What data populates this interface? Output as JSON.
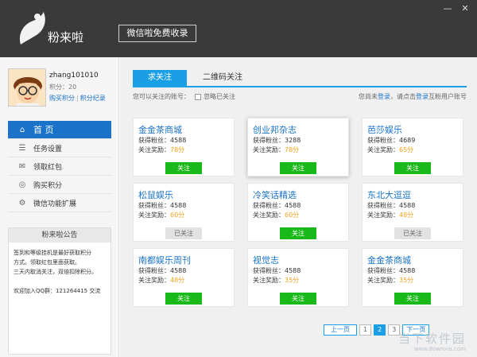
{
  "app": {
    "name": "粉来啦",
    "tagline": "微信啦免费收录"
  },
  "window": {
    "minimize": "—",
    "close": "✕"
  },
  "profile": {
    "username": "zhang101010",
    "points_label": "积分：20",
    "buy_points": "购买积分",
    "separator": "|",
    "points_record": "积分纪录"
  },
  "nav": [
    {
      "label": "首 页",
      "icon": "house-icon",
      "glyph": "⌂"
    },
    {
      "label": "任务设置",
      "icon": "list-icon",
      "glyph": "☰"
    },
    {
      "label": "领取红包",
      "icon": "gift-icon",
      "glyph": "✉"
    },
    {
      "label": "购买积分",
      "icon": "coins-icon",
      "glyph": "◎"
    },
    {
      "label": "微信功能扩展",
      "icon": "gear-icon",
      "glyph": "⚙"
    }
  ],
  "notice": {
    "title": "粉来啦公告",
    "line1": "签到和等级挂机是最好获取积分",
    "line2": "方式。领取红包里面获取。",
    "line3": "三天内取消关注，双倍扣除积分。",
    "qq": "欢迎加入QQ群：121264415 交流"
  },
  "tabs": {
    "active": "求关注",
    "inactive": "二维码关注"
  },
  "subbar": {
    "left": "您可以关注的账号：",
    "ignore": "忽略已关注",
    "right_prefix": "您尚未",
    "login1": "登录",
    "right_mid": "，请点击",
    "login2": "登录",
    "right_suffix": "互粉用户账号"
  },
  "cards": [
    {
      "title": "金金茶商城",
      "fans": "获得粉丝：4588",
      "reward_label": "关注奖励：",
      "reward": "78分",
      "button": "关注",
      "followed": false
    },
    {
      "title": "创业邦杂志",
      "fans": "获得粉丝：3288",
      "reward_label": "关注奖励：",
      "reward": "78分",
      "button": "关注",
      "followed": false
    },
    {
      "title": "芭莎娱乐",
      "fans": "获得粉丝：4689",
      "reward_label": "关注奖励：",
      "reward": "65分",
      "button": "关注",
      "followed": false
    },
    {
      "title": "松鼠娱乐",
      "fans": "获得粉丝：4588",
      "reward_label": "关注奖励：",
      "reward": "60分",
      "button": "已关注",
      "followed": true
    },
    {
      "title": "冷笑话精选",
      "fans": "获得粉丝：4588",
      "reward_label": "关注奖励：",
      "reward": "60分",
      "button": "关注",
      "followed": false
    },
    {
      "title": "东北大逗逗",
      "fans": "获得粉丝：4588",
      "reward_label": "关注奖励：",
      "reward": "48分",
      "button": "已关注",
      "followed": true
    },
    {
      "title": "南都娱乐周刊",
      "fans": "获得粉丝：4588",
      "reward_label": "关注奖励：",
      "reward": "48分",
      "button": "关注",
      "followed": false
    },
    {
      "title": "视觉志",
      "fans": "获得粉丝：4588",
      "reward_label": "关注奖励：",
      "reward": "35分",
      "button": "关注",
      "followed": false
    },
    {
      "title": "金金茶商城",
      "fans": "获得粉丝：4588",
      "reward_label": "关注奖励：",
      "reward": "35分",
      "button": "关注",
      "followed": false
    }
  ],
  "pager": {
    "prev": "上一页",
    "p1": "1",
    "p2": "2",
    "p3": "3",
    "next": "下一页"
  },
  "watermark": {
    "text": "当下软件园",
    "url": "www.downxia.com"
  },
  "colors": {
    "accent": "#1a9fe6",
    "link": "#1a73c9",
    "follow_button": "#18b918",
    "reward": "#f2a31b",
    "header": "#3a3a3a"
  }
}
